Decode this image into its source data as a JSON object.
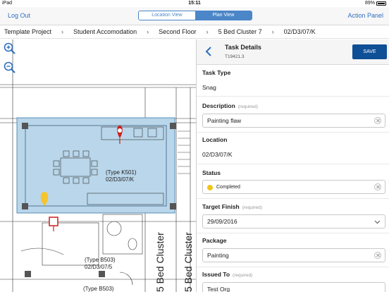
{
  "status_bar": {
    "device": "iPad",
    "time": "15:11",
    "battery": "89%"
  },
  "nav": {
    "logout": "Log Out",
    "segments": {
      "location_view": "Location View",
      "plan_view": "Plan View"
    },
    "action_panel": "Action Panel"
  },
  "breadcrumb": [
    "Template Project",
    "Student Accomodation",
    "Second Floor",
    "5 Bed Cluster 7",
    "02/D3/07/K"
  ],
  "plan": {
    "room_type": "(Type K501)",
    "room_ref": "02/D3/07/K",
    "room_b503_a": "(Type B503)",
    "room_b503_a_ref": "02/D3/07/5",
    "room_b503_b": "(Type B503)",
    "cluster_label_1": "5 Bed Cluster",
    "cluster_label_2": "5 Bed Cluster",
    "colors": {
      "highlight": "#b9d6ea",
      "pin_red": "#cc1f1f",
      "pin_yellow": "#f5c52b"
    }
  },
  "panel": {
    "title": "Task Details",
    "task_id": "T19421.3",
    "save": "SAVE",
    "required_text": "(required)",
    "task_type_label": "Task Type",
    "task_type": "Snag",
    "description_label": "Description",
    "description": "Painting flaw",
    "location_label": "Location",
    "location": "02/D3/07/K",
    "status_label": "Status",
    "status": "Completed",
    "target_finish_label": "Target Finish",
    "target_finish": "29/09/2016",
    "package_label": "Package",
    "package": "Painting",
    "issued_to_label": "Issued To",
    "issued_to": "Test Org",
    "accent": "#0f4f96"
  }
}
